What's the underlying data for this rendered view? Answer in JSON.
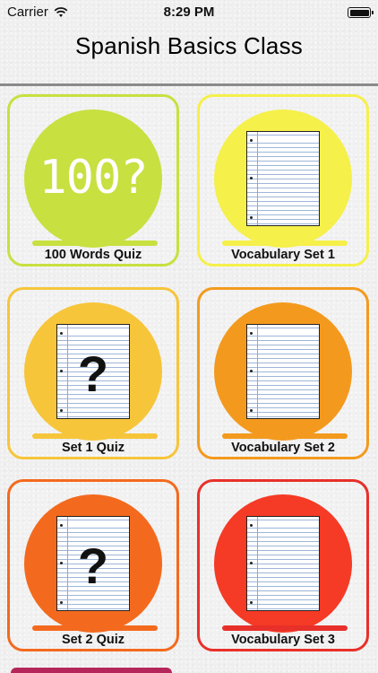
{
  "status_bar": {
    "carrier": "Carrier",
    "time": "8:29 PM"
  },
  "header": {
    "title": "Spanish Basics Class"
  },
  "tiles": [
    {
      "label": "100 Words Quiz",
      "badge": "100?",
      "icon": "hundred-question-icon",
      "border": "#c8e040",
      "circle": "#c8e040",
      "bar": "#c8e040"
    },
    {
      "label": "Vocabulary Set 1",
      "icon": "notebook-paper-icon",
      "border": "#f5f04a",
      "circle": "#f5f04a",
      "bar": "#f5f04a"
    },
    {
      "label": "Set 1 Quiz",
      "qmark": "?",
      "icon": "quiz-paper-icon",
      "border": "#f6c53a",
      "circle": "#f6c53a",
      "bar": "#f6c53a"
    },
    {
      "label": "Vocabulary Set 2",
      "icon": "notebook-paper-icon",
      "border": "#f39a1e",
      "circle": "#f39a1e",
      "bar": "#f39a1e"
    },
    {
      "label": "Set 2 Quiz",
      "qmark": "?",
      "icon": "quiz-paper-icon",
      "border": "#f36a1e",
      "circle": "#f36a1e",
      "bar": "#f36a1e"
    },
    {
      "label": "Vocabulary Set 3",
      "icon": "notebook-paper-icon",
      "border": "#e8302a",
      "circle": "#f53a25",
      "bar": "#e8302a"
    }
  ],
  "colors": {
    "next_tile_edge": "#b5265a"
  }
}
